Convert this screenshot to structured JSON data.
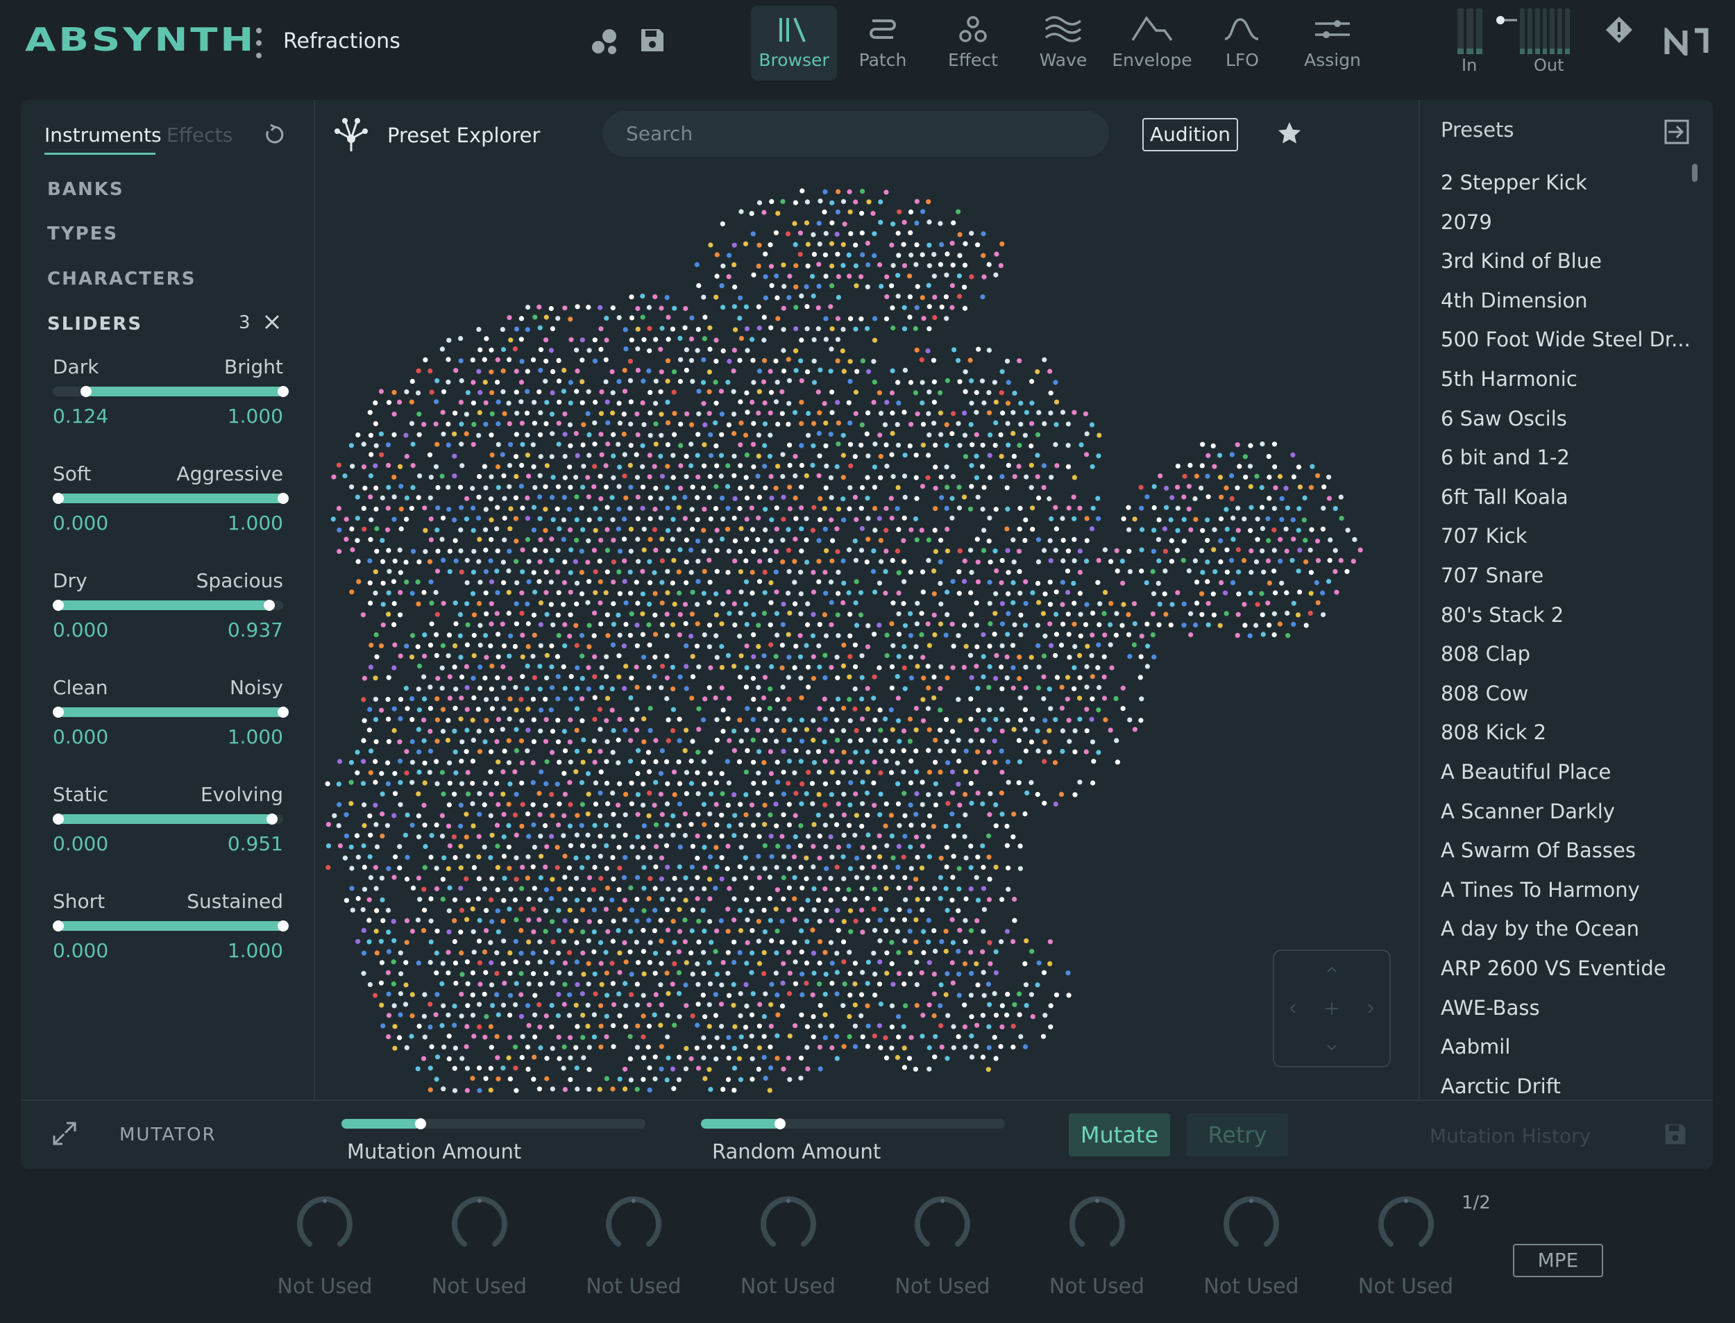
{
  "app": {
    "logo": "ABSYNTH",
    "preset_name": "Refractions"
  },
  "nav": {
    "tabs": [
      {
        "label": "Browser",
        "icon": "library-icon",
        "active": true
      },
      {
        "label": "Patch",
        "icon": "patch-icon"
      },
      {
        "label": "Effect",
        "icon": "effect-icon"
      },
      {
        "label": "Wave",
        "icon": "wave-icon"
      },
      {
        "label": "Envelope",
        "icon": "envelope-icon"
      },
      {
        "label": "LFO",
        "icon": "lfo-icon"
      },
      {
        "label": "Assign",
        "icon": "assign-icon"
      }
    ],
    "meters": {
      "in_label": "In",
      "out_label": "Out"
    }
  },
  "sidebar": {
    "tabs": {
      "instruments": "Instruments",
      "effects": "Effects"
    },
    "categories": {
      "banks": "BANKS",
      "types": "TYPES",
      "characters": "CHARACTERS",
      "sliders": "SLIDERS"
    },
    "sliders_count": "3",
    "sliders": [
      {
        "left": "Dark",
        "right": "Bright",
        "min": "0.124",
        "max": "1.000",
        "min_frac": 0.124,
        "max_frac": 1.0
      },
      {
        "left": "Soft",
        "right": "Aggressive",
        "min": "0.000",
        "max": "1.000",
        "min_frac": 0.0,
        "max_frac": 1.0
      },
      {
        "left": "Dry",
        "right": "Spacious",
        "min": "0.000",
        "max": "0.937",
        "min_frac": 0.0,
        "max_frac": 0.937
      },
      {
        "left": "Clean",
        "right": "Noisy",
        "min": "0.000",
        "max": "1.000",
        "min_frac": 0.0,
        "max_frac": 1.0
      },
      {
        "left": "Static",
        "right": "Evolving",
        "min": "0.000",
        "max": "0.951",
        "min_frac": 0.0,
        "max_frac": 0.951
      },
      {
        "left": "Short",
        "right": "Sustained",
        "min": "0.000",
        "max": "1.000",
        "min_frac": 0.0,
        "max_frac": 1.0
      }
    ]
  },
  "explorer": {
    "title": "Preset Explorer",
    "search_placeholder": "Search",
    "audition_label": "Audition",
    "dot_colors": [
      "#ffffff",
      "#d8e7ee",
      "#5fc4e0",
      "#e882c8",
      "#4f8be0",
      "#f08a3c",
      "#e6c04a",
      "#4cbb6a",
      "#e05050",
      "#9a6fe0"
    ]
  },
  "presets": {
    "title": "Presets",
    "items": [
      "2 Stepper Kick",
      "2079",
      "3rd Kind of Blue",
      "4th Dimension",
      "500 Foot Wide Steel Dr...",
      "5th Harmonic",
      "6 Saw Oscils",
      "6 bit and 1-2",
      "6ft Tall Koala",
      "707 Kick",
      "707 Snare",
      "80's Stack 2",
      "808 Clap",
      "808 Cow",
      "808 Kick 2",
      "A Beautiful Place",
      "A Scanner Darkly",
      "A Swarm Of Basses",
      "A Tines To Harmony",
      "A day by the Ocean",
      "ARP 2600 VS Eventide",
      "AWE-Bass",
      "Aabmil",
      "Aarctic Drift"
    ]
  },
  "mutator": {
    "title": "MUTATOR",
    "mutation_amount_label": "Mutation Amount",
    "mutation_amount": 0.26,
    "random_amount_label": "Random Amount",
    "random_amount": 0.26,
    "mutate_label": "Mutate",
    "retry_label": "Retry",
    "history_label": "Mutation History"
  },
  "macros": {
    "page": "1/2",
    "knobs": [
      "Not Used",
      "Not Used",
      "Not Used",
      "Not Used",
      "Not Used",
      "Not Used",
      "Not Used",
      "Not Used"
    ],
    "mpe_label": "MPE"
  },
  "colors": {
    "accent": "#5fc4ad",
    "background": "#1b2329",
    "panel": "#202b31"
  }
}
